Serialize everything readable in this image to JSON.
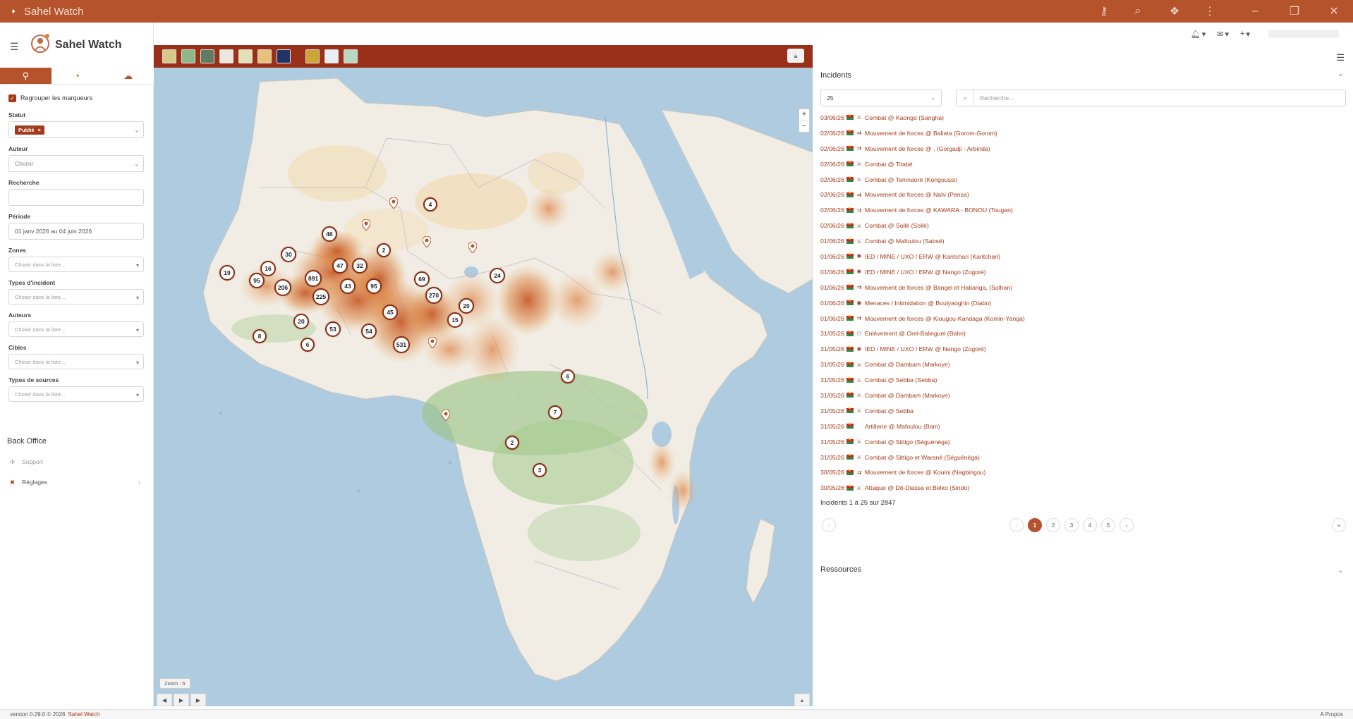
{
  "titlebar": {
    "title": "Sahel Watch"
  },
  "app": {
    "name": "Sahel Watch"
  },
  "sidebar": {
    "group_markers_label": "Regrouper les marqueurs",
    "statut_label": "Statut",
    "statut_tag": "Publié",
    "auteur_label": "Auteur",
    "auteur_placeholder": "Choisir",
    "recherche_label": "Recherche",
    "periode_label": "Période",
    "periode_value": "01 janv 2026 au 04 juin 2026",
    "zones_label": "Zones",
    "types_incident_label": "Types d'incident",
    "auteurs_label": "Auteurs",
    "cibles_label": "Cibles",
    "types_sources_label": "Types de sources",
    "list_placeholder": "Choisir dans la liste...",
    "backoffice_title": "Back Office",
    "support_label": "Support",
    "reglages_label": "Réglages"
  },
  "map": {
    "zoom_label": "Zoom : 5",
    "clusters": [
      {
        "label": "4"
      },
      {
        "label": "46"
      },
      {
        "label": "2"
      },
      {
        "label": "30"
      },
      {
        "label": "47"
      },
      {
        "label": "32"
      },
      {
        "label": "19"
      },
      {
        "label": "16"
      },
      {
        "label": "95"
      },
      {
        "label": "891"
      },
      {
        "label": "206"
      },
      {
        "label": "43"
      },
      {
        "label": "95"
      },
      {
        "label": "69"
      },
      {
        "label": "24"
      },
      {
        "label": "225"
      },
      {
        "label": "270"
      },
      {
        "label": "20"
      },
      {
        "label": "45"
      },
      {
        "label": "15"
      },
      {
        "label": "20"
      },
      {
        "label": "53"
      },
      {
        "label": "54"
      },
      {
        "label": "8"
      },
      {
        "label": "6"
      },
      {
        "label": "531"
      },
      {
        "label": "6"
      },
      {
        "label": "7"
      },
      {
        "label": "2"
      },
      {
        "label": "3"
      }
    ]
  },
  "panel": {
    "incidents_title": "Incidents",
    "page_size": "25",
    "search_placeholder": "Recherche...",
    "summary": "Incidents 1 à 25 sur 2847",
    "ressources_title": "Ressources",
    "pages": [
      "1",
      "2",
      "3",
      "4",
      "5"
    ],
    "incidents": [
      {
        "date": "03/06/26",
        "text": "Combat @ Kaongo (Sangha)",
        "icon": "combat"
      },
      {
        "date": "02/06/26",
        "text": "Mouvement de forces @ Baliata (Gorom-Gorom)",
        "icon": "movement"
      },
      {
        "date": "02/06/26",
        "text": "Mouvement de forces @ , (Gorgadji - Arbinda)",
        "icon": "movement"
      },
      {
        "date": "02/06/26",
        "text": "Combat @ Titabè",
        "icon": "combat"
      },
      {
        "date": "02/06/26",
        "text": "Combat @ Temnaoré (Kongoussi)",
        "icon": "combat"
      },
      {
        "date": "02/06/26",
        "text": "Mouvement de forces @ Nahi (Pensa)",
        "icon": "movement"
      },
      {
        "date": "02/06/26",
        "text": "Mouvement de forces @ KAWARA - BONOU (Tougan)",
        "icon": "movement"
      },
      {
        "date": "02/06/26",
        "text": "Combat @ Sollé (Sollé)",
        "icon": "combat"
      },
      {
        "date": "01/06/26",
        "text": "Combat @ Mafoulou (Sabsé)",
        "icon": "combat"
      },
      {
        "date": "01/06/26",
        "text": "IED / MINE / UXO / ERW @ Kantchari (Kantchari)",
        "icon": "ied"
      },
      {
        "date": "01/06/26",
        "text": "IED / MINE / UXO / ERW @ Nango (Zogoré)",
        "icon": "ied"
      },
      {
        "date": "01/06/26",
        "text": "Mouvement de forces @ Bangel et Habanga, (Solhan)",
        "icon": "movement"
      },
      {
        "date": "01/06/26",
        "text": "Menaces / Intimidation @ Boulyaoghin (Diabo)",
        "icon": "threat"
      },
      {
        "date": "01/06/26",
        "text": "Mouvement de forces @ Kiougou-Kandaga (Komin-Yanga)",
        "icon": "movement"
      },
      {
        "date": "31/05/26",
        "text": "Enlèvement @ Orel-Balinguel (Bahn)",
        "icon": "kidnap"
      },
      {
        "date": "31/05/26",
        "text": "IED / MINE / UXO / ERW @ Nango (Zogoré)",
        "icon": "ied"
      },
      {
        "date": "31/05/26",
        "text": "Combat @ Dambam (Markoye)",
        "icon": "combat"
      },
      {
        "date": "31/05/26",
        "text": "Combat @ Sebba (Sebba)",
        "icon": "combat"
      },
      {
        "date": "31/05/26",
        "text": "Combat @ Dambam (Markoye)",
        "icon": "combat"
      },
      {
        "date": "31/05/26",
        "text": "Combat @ Sebba",
        "icon": "combat"
      },
      {
        "date": "31/05/26",
        "text": "Artillerie @ Mafoulou (Bam)",
        "icon": "none"
      },
      {
        "date": "31/05/26",
        "text": "Combat @ Sittigo (Séguénéga)",
        "icon": "combat"
      },
      {
        "date": "31/05/26",
        "text": "Combat @ Sittigo et Warané (Séguénéga)",
        "icon": "combat"
      },
      {
        "date": "30/05/26",
        "text": "Mouvement de forces @ Kouini (Nagbingou)",
        "icon": "movement"
      },
      {
        "date": "30/05/26",
        "text": "Attaque @ Dô-Diassa et Belko (Sindo)",
        "icon": "combat"
      }
    ]
  },
  "footer": {
    "version": "version 0.29.0 © 2026",
    "brand": "Sahel Watch",
    "about": "A Propos"
  },
  "colors": {
    "brand": "#b5532c",
    "toolbar": "#9a3018",
    "link": "#a63a18"
  }
}
